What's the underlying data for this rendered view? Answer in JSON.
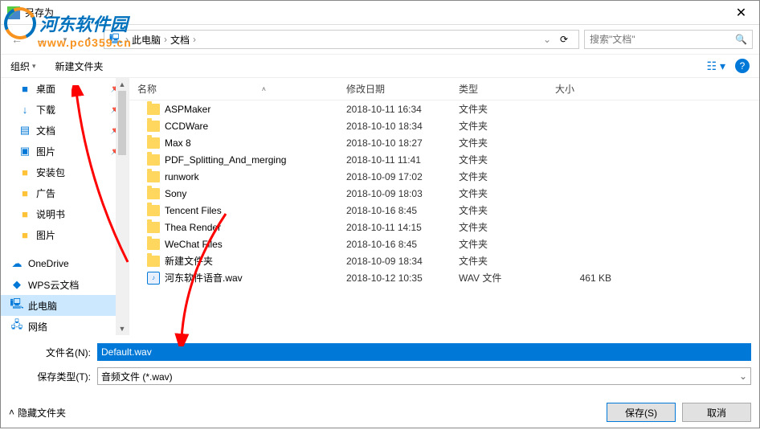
{
  "title": "另存为",
  "watermark": {
    "brand": "河东软件园",
    "url": "www.pc0359.cn"
  },
  "breadcrumb": {
    "up": "↑",
    "items": [
      "",
      "此电脑",
      "文档"
    ]
  },
  "search": {
    "placeholder": "搜索\"文档\""
  },
  "toolbar": {
    "organize": "组织",
    "newfolder": "新建文件夹"
  },
  "cols": {
    "name": "名称",
    "date": "修改日期",
    "type": "类型",
    "size": "大小"
  },
  "sidebar": [
    {
      "label": "桌面",
      "icon": "■",
      "cls": "ico-blue",
      "pin": true
    },
    {
      "label": "下载",
      "icon": "↓",
      "cls": "ico-blue",
      "pin": true
    },
    {
      "label": "文档",
      "icon": "▤",
      "cls": "ico-blue",
      "pin": true
    },
    {
      "label": "图片",
      "icon": "▣",
      "cls": "ico-blue",
      "pin": true
    },
    {
      "label": "安装包",
      "icon": "■",
      "cls": "ico-folder",
      "pin": false
    },
    {
      "label": "广告",
      "icon": "■",
      "cls": "ico-folder",
      "pin": false
    },
    {
      "label": "说明书",
      "icon": "■",
      "cls": "ico-folder",
      "pin": false
    },
    {
      "label": "图片",
      "icon": "■",
      "cls": "ico-folder",
      "pin": false
    }
  ],
  "sidebar2": [
    {
      "label": "OneDrive",
      "icon": "☁",
      "cls": "ico-blue"
    },
    {
      "label": "WPS云文档",
      "icon": "◆",
      "cls": "ico-blue"
    },
    {
      "label": "此电脑",
      "icon": "🖳",
      "cls": "ico-blue",
      "selected": true
    },
    {
      "label": "网络",
      "icon": "🖧",
      "cls": "ico-blue"
    }
  ],
  "files": [
    {
      "name": "ASPMaker",
      "date": "2018-10-11 16:34",
      "type": "文件夹",
      "size": "",
      "folder": true
    },
    {
      "name": "CCDWare",
      "date": "2018-10-10 18:34",
      "type": "文件夹",
      "size": "",
      "folder": true
    },
    {
      "name": "Max 8",
      "date": "2018-10-10 18:27",
      "type": "文件夹",
      "size": "",
      "folder": true
    },
    {
      "name": "PDF_Splitting_And_merging",
      "date": "2018-10-11 11:41",
      "type": "文件夹",
      "size": "",
      "folder": true
    },
    {
      "name": "runwork",
      "date": "2018-10-09 17:02",
      "type": "文件夹",
      "size": "",
      "folder": true
    },
    {
      "name": "Sony",
      "date": "2018-10-09 18:03",
      "type": "文件夹",
      "size": "",
      "folder": true
    },
    {
      "name": "Tencent Files",
      "date": "2018-10-16 8:45",
      "type": "文件夹",
      "size": "",
      "folder": true
    },
    {
      "name": "Thea Render",
      "date": "2018-10-11 14:15",
      "type": "文件夹",
      "size": "",
      "folder": true
    },
    {
      "name": "WeChat Files",
      "date": "2018-10-16 8:45",
      "type": "文件夹",
      "size": "",
      "folder": true
    },
    {
      "name": "新建文件夹",
      "date": "2018-10-09 18:34",
      "type": "文件夹",
      "size": "",
      "folder": true
    },
    {
      "name": "河东软件语音.wav",
      "date": "2018-10-12 10:35",
      "type": "WAV 文件",
      "size": "461 KB",
      "folder": false
    }
  ],
  "form": {
    "fn_label": "文件名(N):",
    "fn_value": "Default.wav",
    "type_label": "保存类型(T):",
    "type_value": "音频文件 (*.wav)"
  },
  "footer": {
    "hide": "隐藏文件夹",
    "save": "保存(S)",
    "cancel": "取消"
  }
}
